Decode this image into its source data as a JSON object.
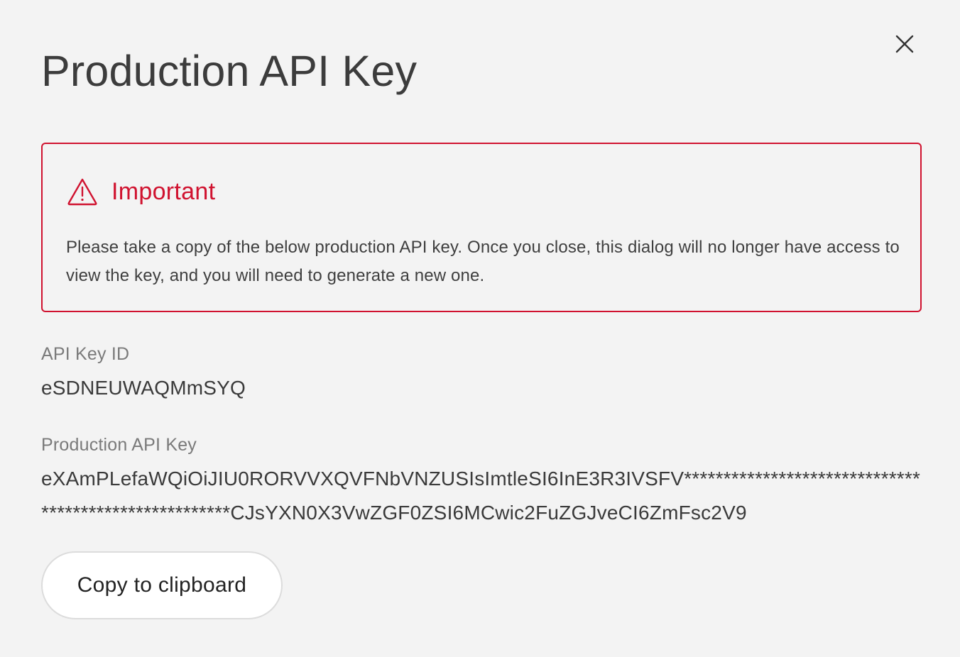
{
  "dialog": {
    "title": "Production API Key",
    "close_icon": "close-icon"
  },
  "warning": {
    "icon": "warning-triangle-icon",
    "title": "Important",
    "message": "Please take a copy of the below production API key. Once you close, this dialog will no longer have access to view the key, and you will need to generate a new one.",
    "color": "#d0122f"
  },
  "fields": {
    "key_id_label": "API Key ID",
    "key_id_value": "eSDNEUWAQMmSYQ",
    "api_key_label": "Production API Key",
    "api_key_value": "eXAmPLefaWQiOiJIU0RORVVXQVFNbVNZUSIsImtleSI6InE3R3IVSFV******************************************************CJsYXN0X3VwZGF0ZSI6MCwic2FuZGJveCI6ZmFsc2V9"
  },
  "actions": {
    "copy_label": "Copy to clipboard"
  }
}
